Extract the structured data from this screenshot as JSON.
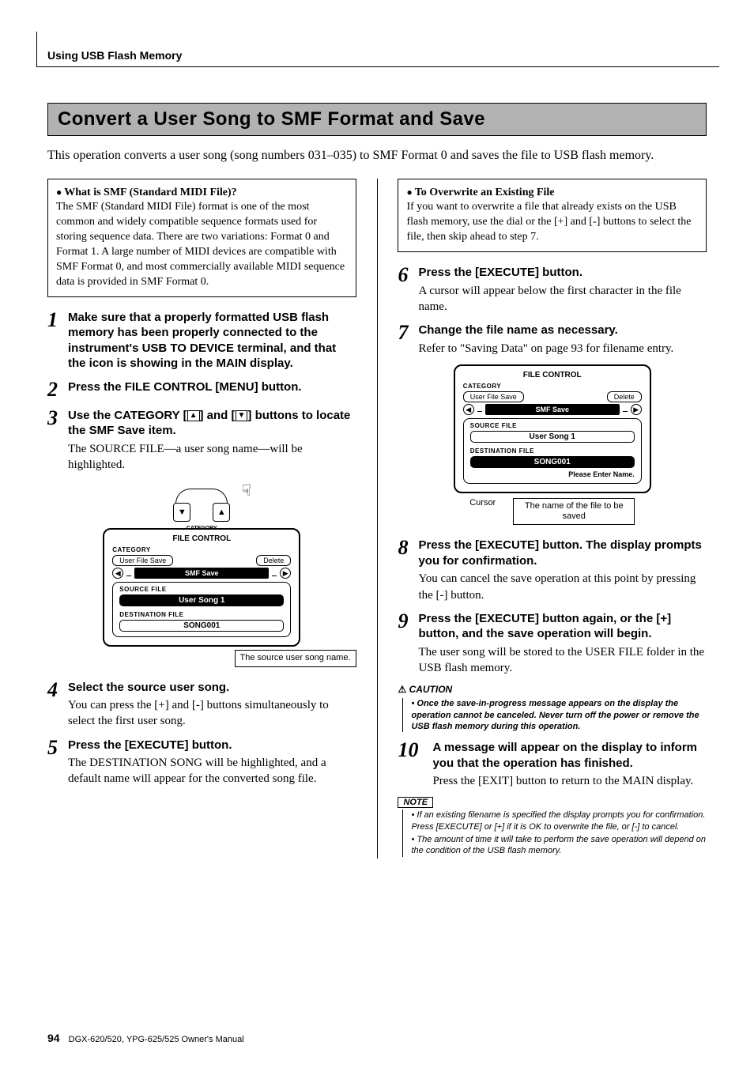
{
  "running_head": "Using USB Flash Memory",
  "section_title": "Convert a User Song to SMF Format and Save",
  "intro": "This operation converts a user song (song numbers 031–035) to SMF Format 0 and saves the file to USB flash memory.",
  "smf_box": {
    "title": "What is SMF (Standard MIDI File)?",
    "body": "The SMF (Standard MIDI File) format is one of the most common and widely compatible sequence formats used for storing sequence data. There are two variations: Format 0 and Format 1. A large number of MIDI devices are compatible with SMF Format 0, and most commercially available MIDI sequence data is provided in SMF Format 0."
  },
  "overwrite_box": {
    "title": "To Overwrite an Existing File",
    "body": "If you want to overwrite a file that already exists on the USB flash memory, use the dial or the [+] and [-] buttons to select the file, then skip ahead to step 7."
  },
  "steps": {
    "s1": {
      "num": "1",
      "head": "Make sure that a properly formatted USB flash memory has been properly connected to the instrument's USB TO DEVICE terminal, and that the icon is showing in the MAIN display."
    },
    "s2": {
      "num": "2",
      "head": "Press the FILE CONTROL [MENU] button."
    },
    "s3": {
      "num": "3",
      "head_a": "Use the CATEGORY [",
      "head_b": "] and [",
      "head_c": "] buttons to locate the SMF Save item.",
      "text": "The SOURCE FILE—a user song name—will be highlighted."
    },
    "s4": {
      "num": "4",
      "head": "Select the source user song.",
      "text": "You can press the [+] and [-] buttons simultaneously to select the first user song."
    },
    "s5": {
      "num": "5",
      "head": "Press the [EXECUTE] button.",
      "text": "The DESTINATION SONG will be highlighted, and a default name will appear for the converted song file."
    },
    "s6": {
      "num": "6",
      "head": "Press the [EXECUTE] button.",
      "text": "A cursor will appear below the first character in the file name."
    },
    "s7": {
      "num": "7",
      "head": "Change the file name as necessary.",
      "text": "Refer to \"Saving Data\" on page 93 for filename entry."
    },
    "s8": {
      "num": "8",
      "head": "Press the [EXECUTE] button. The display prompts you for confirmation.",
      "text": "You can cancel the save operation at this point by pressing the [-] button."
    },
    "s9": {
      "num": "9",
      "head": "Press the [EXECUTE] button again, or the [+] button, and the save operation will begin.",
      "text": "The user song will be stored to the USER FILE folder in the USB flash memory."
    },
    "s10": {
      "num": "10",
      "head": "A message will appear on the display to inform you that the operation has finished.",
      "text": "Press the [EXIT] button to return to the MAIN display."
    }
  },
  "lcd": {
    "title": "FILE CONTROL",
    "cat_label": "CATEGORY",
    "pill_left": "User File Save",
    "pill_right": "Delete",
    "center": "SMF Save",
    "src_label": "SOURCE FILE",
    "src_value": "User Song 1",
    "dst_label": "DESTINATION FILE",
    "dst_value": "SONG001",
    "prompt": "Please Enter Name."
  },
  "fig_left_callout": "The source user song name.",
  "fig_buttons_label": "CATEGORY",
  "fig_right": {
    "cursor": "Cursor",
    "name_box": "The name of the file to be saved"
  },
  "caution": {
    "label": "CAUTION",
    "item": "Once the save-in-progress message appears on the display the operation cannot be canceled. Never turn off the power or remove the USB flash memory during this operation."
  },
  "note": {
    "label": "NOTE",
    "item1": "If an existing filename is specified the display prompts you for confirmation. Press [EXECUTE] or [+] if it is OK to overwrite the file, or [-] to cancel.",
    "item2": "The amount of time it will take to perform the save operation will depend on the condition of the USB flash memory."
  },
  "footer": {
    "page": "94",
    "manual": "DGX-620/520, YPG-625/525 Owner's Manual"
  }
}
